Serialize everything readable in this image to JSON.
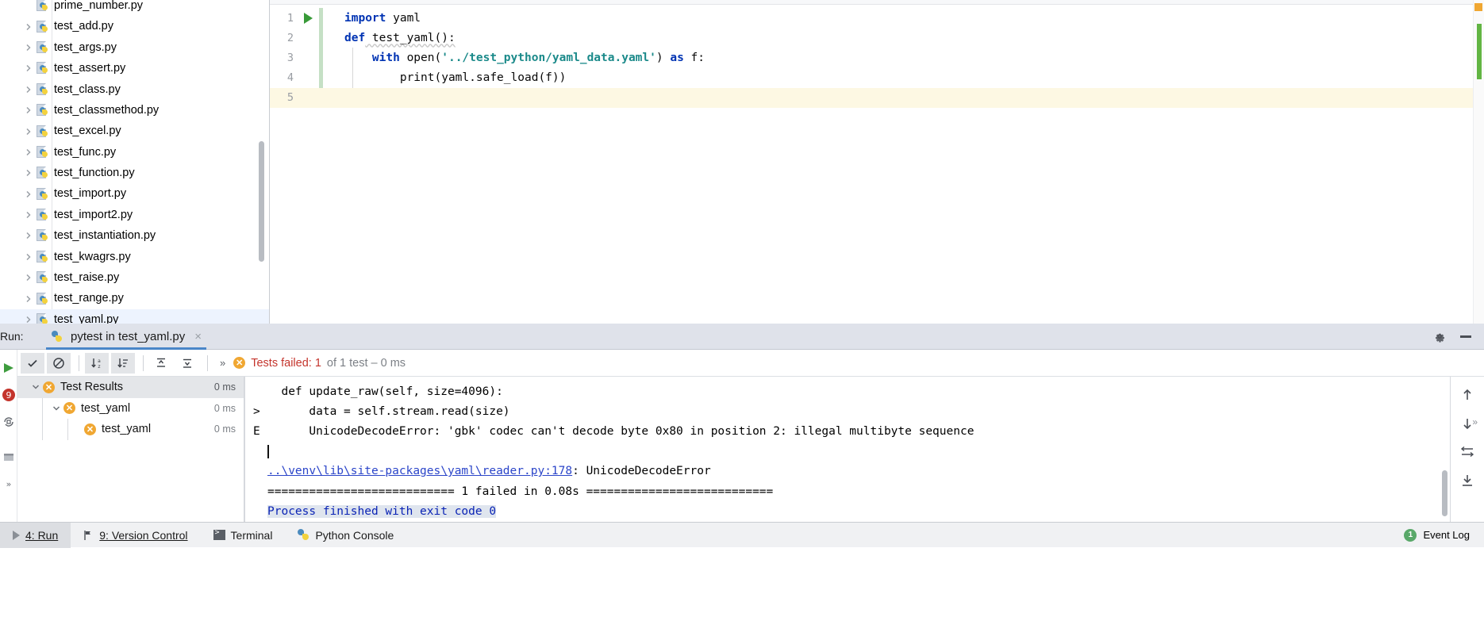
{
  "project_tree": {
    "items": [
      {
        "label": "prime_number.py",
        "icon": "python-file-icon",
        "has_chevron": false,
        "selected": false
      },
      {
        "label": "test_add.py",
        "icon": "python-file-icon",
        "has_chevron": true,
        "selected": false
      },
      {
        "label": "test_args.py",
        "icon": "python-file-icon",
        "has_chevron": true,
        "selected": false
      },
      {
        "label": "test_assert.py",
        "icon": "python-file-icon",
        "has_chevron": true,
        "selected": false
      },
      {
        "label": "test_class.py",
        "icon": "python-file-icon",
        "has_chevron": true,
        "selected": false
      },
      {
        "label": "test_classmethod.py",
        "icon": "python-file-icon",
        "has_chevron": true,
        "selected": false
      },
      {
        "label": "test_excel.py",
        "icon": "python-file-icon",
        "has_chevron": true,
        "selected": false
      },
      {
        "label": "test_func.py",
        "icon": "python-file-icon",
        "has_chevron": true,
        "selected": false
      },
      {
        "label": "test_function.py",
        "icon": "python-file-icon",
        "has_chevron": true,
        "selected": false
      },
      {
        "label": "test_import.py",
        "icon": "python-file-icon",
        "has_chevron": true,
        "selected": false
      },
      {
        "label": "test_import2.py",
        "icon": "python-file-icon",
        "has_chevron": true,
        "selected": false
      },
      {
        "label": "test_instantiation.py",
        "icon": "python-file-icon",
        "has_chevron": true,
        "selected": false
      },
      {
        "label": "test_kwagrs.py",
        "icon": "python-file-icon",
        "has_chevron": true,
        "selected": false
      },
      {
        "label": "test_raise.py",
        "icon": "python-file-icon",
        "has_chevron": true,
        "selected": false
      },
      {
        "label": "test_range.py",
        "icon": "python-file-icon",
        "has_chevron": true,
        "selected": false
      },
      {
        "label": "test_yaml.py",
        "icon": "python-file-icon",
        "has_chevron": true,
        "selected": true
      }
    ]
  },
  "editor": {
    "lines": [
      {
        "num": "1",
        "gutter_icon": "run-triangle-icon",
        "current": false
      },
      {
        "num": "2",
        "gutter_icon": "",
        "current": false
      },
      {
        "num": "3",
        "gutter_icon": "",
        "current": false
      },
      {
        "num": "4",
        "gutter_icon": "",
        "current": false
      },
      {
        "num": "5",
        "gutter_icon": "",
        "current": true
      }
    ],
    "code": {
      "l1_kw": "import",
      "l1_mod": " yaml",
      "l2_kw": "def",
      "l2_name": " test_yaml():",
      "l3_kw": "with",
      "l3_open": " open(",
      "l3_q1": "'",
      "l3_path": "../test_python/yaml_data.yaml",
      "l3_q2": "'",
      "l3_close": ") ",
      "l3_as": "as",
      "l3_f": " f:",
      "l4_text": "print(yaml.safe_load(f))"
    }
  },
  "run_window": {
    "label": "Run:",
    "tab": {
      "title": "pytest in test_yaml.py",
      "icon": "python-config-icon",
      "close": "×"
    },
    "header_actions": [
      {
        "name": "settings-gear-icon",
        "label": ""
      },
      {
        "name": "hide-window-icon",
        "label": ""
      }
    ],
    "toolbar": {
      "buttons": [
        {
          "name": "show-passed-button",
          "icon": "check-icon"
        },
        {
          "name": "show-ignored-button",
          "icon": "ignored-icon"
        },
        {
          "name": "sort-alphabetically-button",
          "icon": "sort-az-icon"
        },
        {
          "name": "sort-by-duration-button",
          "icon": "sort-duration-icon"
        },
        {
          "name": "expand-all-button",
          "icon": "expand-all-icon"
        },
        {
          "name": "collapse-all-button",
          "icon": "collapse-all-icon"
        }
      ],
      "overflow": "»"
    },
    "status": {
      "icon": "test-failed-icon",
      "failed_text": "Tests failed: 1",
      "of_text": "of 1 test – 0 ms"
    },
    "tests_tree": [
      {
        "label": "Test Results",
        "time": "0 ms",
        "depth": 0,
        "chevron": "expanded",
        "icon": "test-failed-icon",
        "selected": true
      },
      {
        "label": "test_yaml",
        "time": "0 ms",
        "depth": 1,
        "chevron": "expanded",
        "icon": "test-failed-icon",
        "selected": false
      },
      {
        "label": "test_yaml",
        "time": "0 ms",
        "depth": 2,
        "chevron": "none",
        "icon": "test-failed-icon",
        "selected": false
      }
    ],
    "console": [
      {
        "prefix": "",
        "text": "  def update_raw(self, size=4096):",
        "style": "plain"
      },
      {
        "prefix": ">",
        "text": "      data = self.stream.read(size)",
        "style": "plain"
      },
      {
        "prefix": "E",
        "text": "      UnicodeDecodeError: 'gbk' codec can't decode byte 0x80 in position 2: illegal multibyte sequence",
        "style": "plain"
      },
      {
        "prefix": "",
        "text": "",
        "style": "caret"
      },
      {
        "prefix": "",
        "text": "..\\venv\\lib\\site-packages\\yaml\\reader.py:178",
        "suffix": ": UnicodeDecodeError",
        "style": "link"
      },
      {
        "prefix": "",
        "text": "=========================== 1 failed in 0.08s ===========================",
        "style": "plain"
      },
      {
        "prefix": "",
        "text": "Process finished with exit code 0",
        "style": "selected"
      }
    ],
    "side_actions": [
      {
        "name": "prev-occurrence-icon",
        "glyph": "↑"
      },
      {
        "name": "next-occurrence-icon",
        "glyph": "↓"
      },
      {
        "name": "soft-wrap-icon",
        "glyph": "⇄"
      },
      {
        "name": "scroll-to-end-icon",
        "glyph": "↧"
      }
    ]
  },
  "status_bar": {
    "items": [
      {
        "label": "4: Run",
        "icon": "run-icon",
        "active": true,
        "underline_char": "4"
      },
      {
        "label": "9: Version Control",
        "icon": "vcs-branch-icon",
        "active": false,
        "underline_char": "9"
      },
      {
        "label": "Terminal",
        "icon": "terminal-icon",
        "active": false
      },
      {
        "label": "Python Console",
        "icon": "python-console-icon",
        "active": false
      }
    ],
    "event_log": {
      "label": "Event Log",
      "badge": "1",
      "badge_color": "#59a869"
    }
  },
  "colors": {
    "accent_blue": "#4a86c8",
    "error_red": "#c4342c",
    "warn_orange": "#f0a732",
    "success_green": "#59a869",
    "keyword_blue": "#0033b3",
    "string_teal": "#1b8a8a",
    "link_blue": "#2b45c9",
    "panel_bg": "#dfe2ea",
    "status_bar_bg": "#f0f1f3"
  }
}
